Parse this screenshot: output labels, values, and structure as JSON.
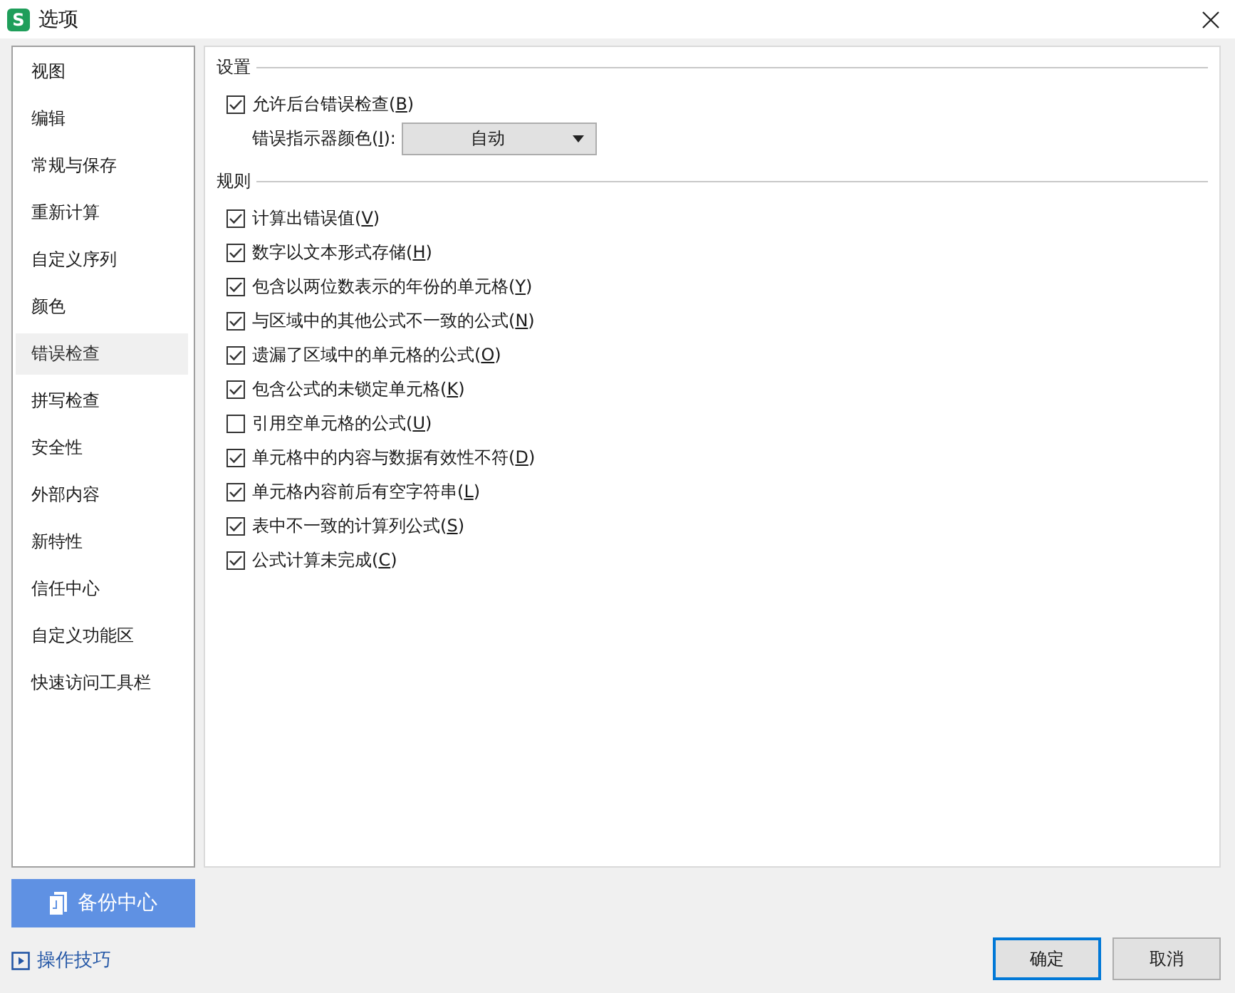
{
  "window": {
    "title": "选项",
    "logo": "S"
  },
  "sidebar": {
    "items": [
      {
        "label": "视图",
        "selected": false
      },
      {
        "label": "编辑",
        "selected": false
      },
      {
        "label": "常规与保存",
        "selected": false
      },
      {
        "label": "重新计算",
        "selected": false
      },
      {
        "label": "自定义序列",
        "selected": false
      },
      {
        "label": "颜色",
        "selected": false
      },
      {
        "label": "错误检查",
        "selected": true
      },
      {
        "label": "拼写检查",
        "selected": false
      },
      {
        "label": "安全性",
        "selected": false
      },
      {
        "label": "外部内容",
        "selected": false
      },
      {
        "label": "新特性",
        "selected": false
      },
      {
        "label": "信任中心",
        "selected": false
      },
      {
        "label": "自定义功能区",
        "selected": false
      },
      {
        "label": "快速访问工具栏",
        "selected": false
      }
    ]
  },
  "settings": {
    "title": "设置",
    "options": [
      {
        "label": "允许后台错误检查(",
        "access_key": "B",
        "label_end": ")",
        "checked": true
      }
    ],
    "color_field": {
      "label": "错误指示器颜色(",
      "access_key": "I",
      "label_end": "):",
      "value": "自动"
    }
  },
  "rules": {
    "title": "规则",
    "items": [
      {
        "label": "计算出错误值(",
        "access_key": "V",
        "label_end": ")",
        "checked": true
      },
      {
        "label": "数字以文本形式存储(",
        "access_key": "H",
        "label_end": ")",
        "checked": true
      },
      {
        "label": "包含以两位数表示的年份的单元格(",
        "access_key": "Y",
        "label_end": ")",
        "checked": true
      },
      {
        "label": "与区域中的其他公式不一致的公式(",
        "access_key": "N",
        "label_end": ")",
        "checked": true
      },
      {
        "label": "遗漏了区域中的单元格的公式(",
        "access_key": "O",
        "label_end": ")",
        "checked": true
      },
      {
        "label": "包含公式的未锁定单元格(",
        "access_key": "K",
        "label_end": ")",
        "checked": true
      },
      {
        "label": "引用空单元格的公式(",
        "access_key": "U",
        "label_end": ")",
        "checked": false
      },
      {
        "label": "单元格中的内容与数据有效性不符(",
        "access_key": "D",
        "label_end": ")",
        "checked": true
      },
      {
        "label": "单元格内容前后有空字符串(",
        "access_key": "L",
        "label_end": ")",
        "checked": true
      },
      {
        "label": "表中不一致的计算列公式(",
        "access_key": "S",
        "label_end": ")",
        "checked": true
      },
      {
        "label": "公式计算未完成(",
        "access_key": "C",
        "label_end": ")",
        "checked": true
      }
    ]
  },
  "backup_button": {
    "label": "备份中心"
  },
  "tips_link": {
    "label": "操作技巧"
  },
  "buttons": [
    {
      "label": "确定",
      "default": true
    },
    {
      "label": "取消",
      "default": false
    }
  ]
}
